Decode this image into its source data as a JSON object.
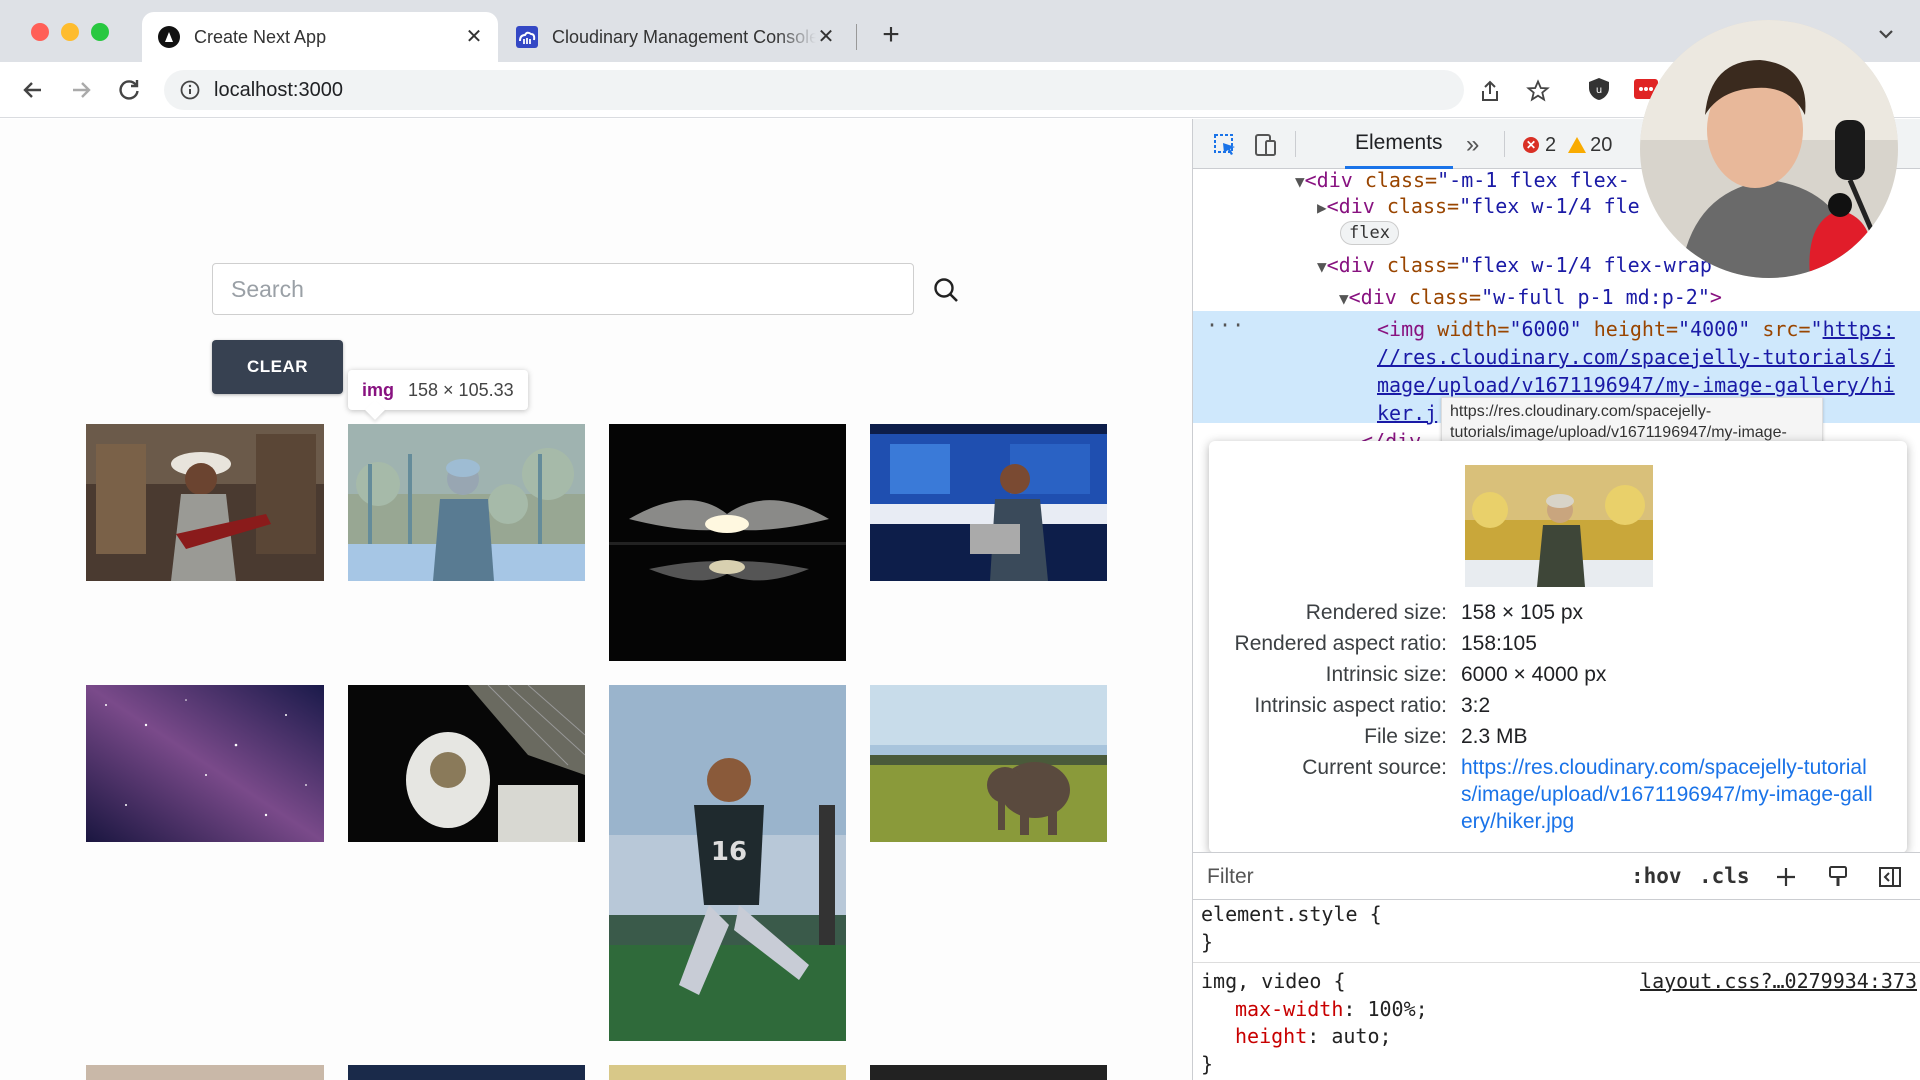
{
  "browser": {
    "tabs": [
      {
        "title": "Create Next App",
        "active": true
      },
      {
        "title": "Cloudinary Management Console",
        "active": false
      }
    ],
    "url": "localhost:3000"
  },
  "page": {
    "search_placeholder": "Search",
    "clear_label": "CLEAR",
    "hover_tooltip": {
      "tag": "img",
      "dims": "158 × 105.33"
    }
  },
  "devtools": {
    "tab": "Elements",
    "errors": "2",
    "warnings": "20",
    "dom": {
      "l1_tag": "<div",
      "l1_attr": " class=",
      "l1_val": "\"-m-1 flex flex-",
      "l2_tag": "<div",
      "l2_attr": " class=",
      "l2_val": "\"flex w-1/4 fle",
      "flex_badge": "flex",
      "l3_tag": "<div",
      "l3_attr": " class=",
      "l3_val": "\"flex w-1/4 flex-wrap",
      "l4_tag": "<div",
      "l4_attr": " class=",
      "l4_val": "\"w-full p-1 md:p-2\"",
      "l4_close": ">",
      "img_open": "<img",
      "img_w_attr": " width=",
      "img_w_val": "\"6000\"",
      "img_h_attr": " height=",
      "img_h_val": "\"4000\"",
      "img_src_attr": " src=",
      "img_src_q": "\"",
      "img_src_1": "https:",
      "img_src_2": "//res.cloudinary.com/spacejelly-tutorials/i",
      "img_src_3": "mage/upload/v1671196947/my-image-gallery/hi",
      "img_src_4": "ker.j",
      "close_div": "</div"
    },
    "url_tooltip": "https://res.cloudinary.com/spacejelly-tutorials/image/upload/v1671196947/my-image-gallery/hiker.jpg",
    "image_info": {
      "rendered_size_label": "Rendered size:",
      "rendered_size": "158 × 105 px",
      "rendered_aspect_label": "Rendered aspect ratio:",
      "rendered_aspect": "158:105",
      "intrinsic_size_label": "Intrinsic size:",
      "intrinsic_size": "6000 × 4000 px",
      "intrinsic_aspect_label": "Intrinsic aspect ratio:",
      "intrinsic_aspect": "3:2",
      "file_size_label": "File size:",
      "file_size": "2.3 MB",
      "current_source_label": "Current source:",
      "current_source": "https://res.cloudinary.com/spacejelly-tutorials/image/upload/v1671196947/my-image-gallery/hiker.jpg"
    },
    "filter": {
      "placeholder": "Filter",
      "hov": ":hov",
      "cls": ".cls"
    },
    "styles": {
      "element_style": "element.style {",
      "close_brace": "}",
      "rule_selector": "img, video {",
      "rule_source": "layout.css?…0279934:373",
      "p1_name": "max-width",
      "p1_value": "100%;",
      "p2_name": "height",
      "p2_value": "auto;"
    }
  },
  "colors": {
    "clear_button": "#374151",
    "selection": "#cfe8fc",
    "link": "#1a73e8"
  }
}
